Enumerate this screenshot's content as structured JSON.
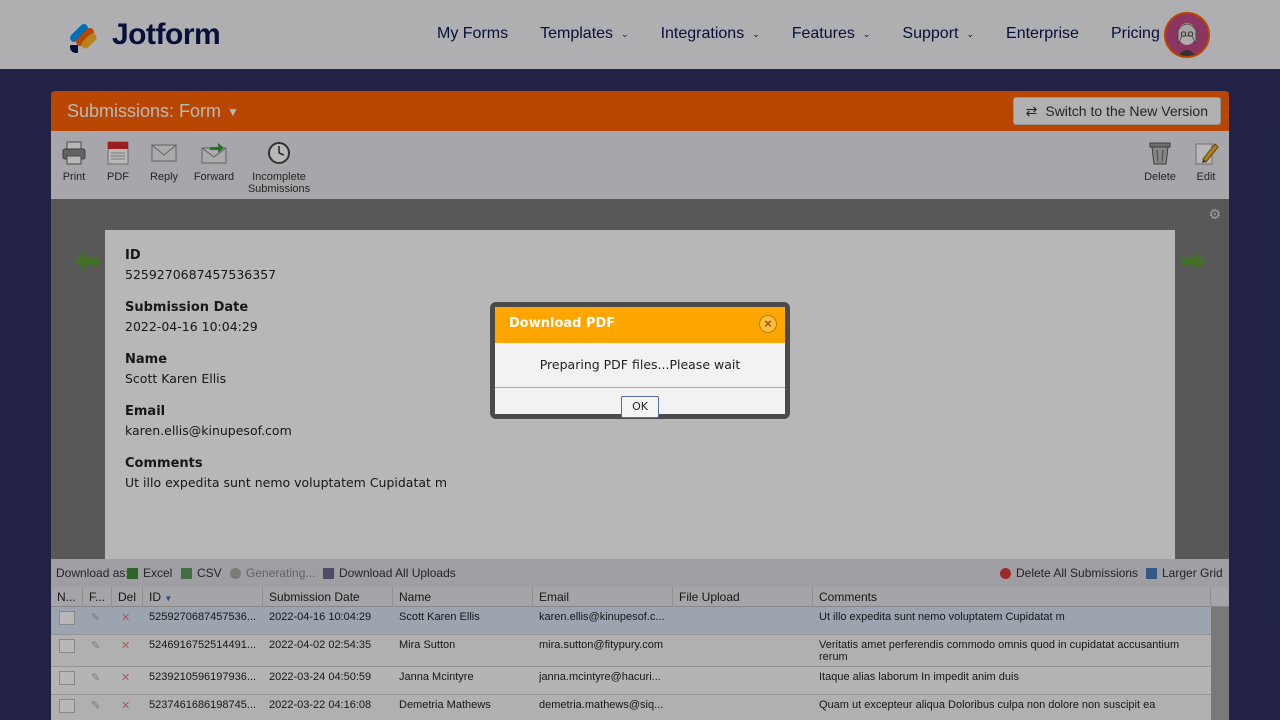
{
  "brand": {
    "name": "Jotform"
  },
  "nav": {
    "items": [
      {
        "label": "My Forms",
        "has_dropdown": false
      },
      {
        "label": "Templates",
        "has_dropdown": true
      },
      {
        "label": "Integrations",
        "has_dropdown": true
      },
      {
        "label": "Features",
        "has_dropdown": true
      },
      {
        "label": "Support",
        "has_dropdown": true
      },
      {
        "label": "Enterprise",
        "has_dropdown": false
      },
      {
        "label": "Pricing",
        "has_dropdown": false
      }
    ]
  },
  "panel": {
    "title": "Submissions: Form",
    "switch_label": "Switch to the New Version"
  },
  "toolbar": {
    "print": "Print",
    "pdf": "PDF",
    "reply": "Reply",
    "forward": "Forward",
    "incomplete_line1": "Incomplete",
    "incomplete_line2": "Submissions",
    "delete": "Delete",
    "edit": "Edit"
  },
  "submission": {
    "fields": [
      {
        "label": "ID",
        "value": "5259270687457536357"
      },
      {
        "label": "Submission Date",
        "value": "2022-04-16 10:04:29"
      },
      {
        "label": "Name",
        "value": "Scott Karen Ellis"
      },
      {
        "label": "Email",
        "value": "karen.ellis@kinupesof.com"
      },
      {
        "label": "Comments",
        "value": "Ut illo expedita sunt nemo voluptatem Cupidatat m"
      }
    ]
  },
  "gridbar": {
    "download_as": "Download as:",
    "excel": "Excel",
    "csv": "CSV",
    "generating": "Generating...",
    "download_uploads": "Download All Uploads",
    "delete_all": "Delete All Submissions",
    "larger_grid": "Larger Grid"
  },
  "grid": {
    "columns": [
      "N...",
      "F...",
      "Del",
      "ID",
      "Submission Date",
      "Name",
      "Email",
      "File Upload",
      "Comments"
    ],
    "rows": [
      {
        "id": "5259270687457536...",
        "date": "2022-04-16 10:04:29",
        "name": "Scott Karen Ellis",
        "email": "karen.ellis@kinupesof.c...",
        "comments": "Ut illo expedita sunt nemo voluptatem Cupidatat m"
      },
      {
        "id": "5246916752514491...",
        "date": "2022-04-02 02:54:35",
        "name": "Mira Sutton",
        "email": "mira.sutton@fitypury.com",
        "comments": "Veritatis amet perferendis commodo omnis quod in cupidatat accusantium rerum"
      },
      {
        "id": "5239210596197936...",
        "date": "2022-03-24 04:50:59",
        "name": "Janna Mcintyre",
        "email": "janna.mcintyre@hacuri...",
        "comments": "Itaque alias laborum In impedit anim duis"
      },
      {
        "id": "5237461686198745...",
        "date": "2022-03-22 04:16:08",
        "name": "Demetria Mathews",
        "email": "demetria.mathews@siq...",
        "comments": "Quam ut excepteur aliqua Doloribus culpa non dolore non suscipit ea"
      }
    ]
  },
  "modal": {
    "title": "Download PDF",
    "message": "Preparing PDF files...Please wait",
    "ok_label": "OK",
    "close_glyph": "×"
  },
  "colors": {
    "nav_bg": "#f3f3f5",
    "page_bg": "#2e3060",
    "brand_orange": "#ff6100",
    "modal_header": "#ffa500",
    "text_navy": "#0a1551"
  }
}
